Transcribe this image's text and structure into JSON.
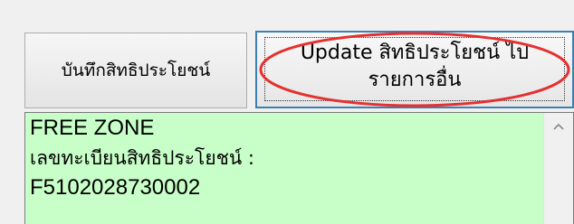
{
  "buttons": {
    "save_label": "บันทึกสิทธิประโยชน์",
    "update_label_line1": "Update สิทธิประโยชน์ ไป",
    "update_label_line2": "รายการอื่น"
  },
  "textbox": {
    "line1": "FREE ZONE",
    "line2": "เลขทะเบียนสิทธิประโยชน์ :",
    "line3": "F5102028730002",
    "background": "#c8ffc8"
  },
  "annotation": {
    "color": "#e53030"
  },
  "icons": {
    "scroll_up": "chevron-up-icon"
  }
}
